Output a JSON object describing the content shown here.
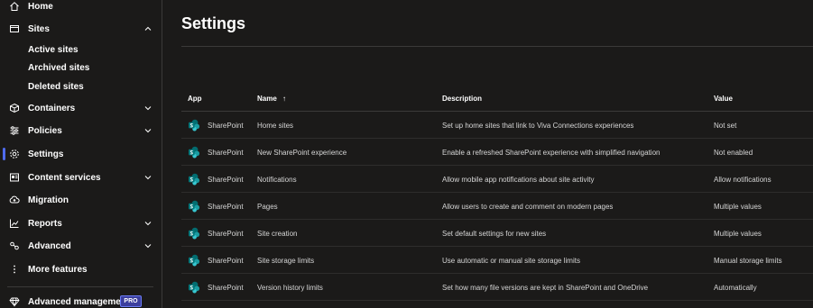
{
  "sidebar": {
    "home": "Home",
    "sites": "Sites",
    "sites_sub": [
      "Active sites",
      "Archived sites",
      "Deleted sites"
    ],
    "containers": "Containers",
    "policies": "Policies",
    "settings": "Settings",
    "content_services": "Content services",
    "migration": "Migration",
    "reports": "Reports",
    "advanced": "Advanced",
    "more_features": "More features",
    "advanced_management": "Advanced management",
    "pro_badge": "PRO"
  },
  "main": {
    "title": "Settings",
    "columns": {
      "app": "App",
      "name": "Name",
      "sort_indicator": "↑",
      "description": "Description",
      "value": "Value"
    },
    "rows": [
      {
        "app": "SharePoint",
        "name": "Home sites",
        "description": "Set up home sites that link to Viva Connections experiences",
        "value": "Not set"
      },
      {
        "app": "SharePoint",
        "name": "New SharePoint experience",
        "description": "Enable a refreshed SharePoint experience with simplified navigation",
        "value": "Not enabled"
      },
      {
        "app": "SharePoint",
        "name": "Notifications",
        "description": "Allow mobile app notifications about site activity",
        "value": "Allow notifications"
      },
      {
        "app": "SharePoint",
        "name": "Pages",
        "description": "Allow users to create and comment on modern pages",
        "value": "Multiple values"
      },
      {
        "app": "SharePoint",
        "name": "Site creation",
        "description": "Set default settings for new sites",
        "value": "Multiple values"
      },
      {
        "app": "SharePoint",
        "name": "Site storage limits",
        "description": "Use automatic or manual site storage limits",
        "value": "Manual storage limits"
      },
      {
        "app": "SharePoint",
        "name": "Version history limits",
        "description": "Set how many file versions are kept in SharePoint and OneDrive",
        "value": "Automatically"
      }
    ]
  },
  "colors": {
    "background": "#1b1a19",
    "accent": "#4f6bed",
    "sharepoint": "#03787c"
  },
  "icons": [
    "home-icon",
    "sites-icon",
    "containers-icon",
    "policies-icon",
    "settings-icon",
    "content-services-icon",
    "migration-icon",
    "reports-icon",
    "advanced-icon",
    "more-icon",
    "diamond-icon",
    "chevron-up-icon",
    "chevron-down-icon",
    "sharepoint-icon"
  ]
}
